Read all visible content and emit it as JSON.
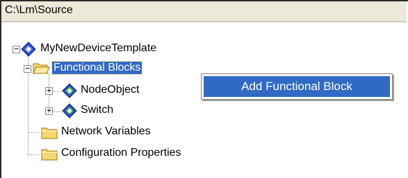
{
  "path_bar": {
    "text": "C:\\Lm\\Source"
  },
  "tree": {
    "root": {
      "label": "MyNewDeviceTemplate",
      "expander": "−"
    },
    "functional_blocks": {
      "label": "Functional Blocks",
      "expander": "−"
    },
    "node_object": {
      "label": "NodeObject",
      "expander": "+"
    },
    "switch": {
      "label": "Switch",
      "expander": "+"
    },
    "network_variables": {
      "label": "Network Variables"
    },
    "configuration_properties": {
      "label": "Configuration Properties"
    }
  },
  "context_menu": {
    "items": [
      {
        "label": "Add Functional Block"
      }
    ]
  },
  "colors": {
    "selection": "#316ac5",
    "folder": "#f5d76e",
    "diamond_blue": "#2a4fd0",
    "diamond_green": "#3fae49"
  }
}
